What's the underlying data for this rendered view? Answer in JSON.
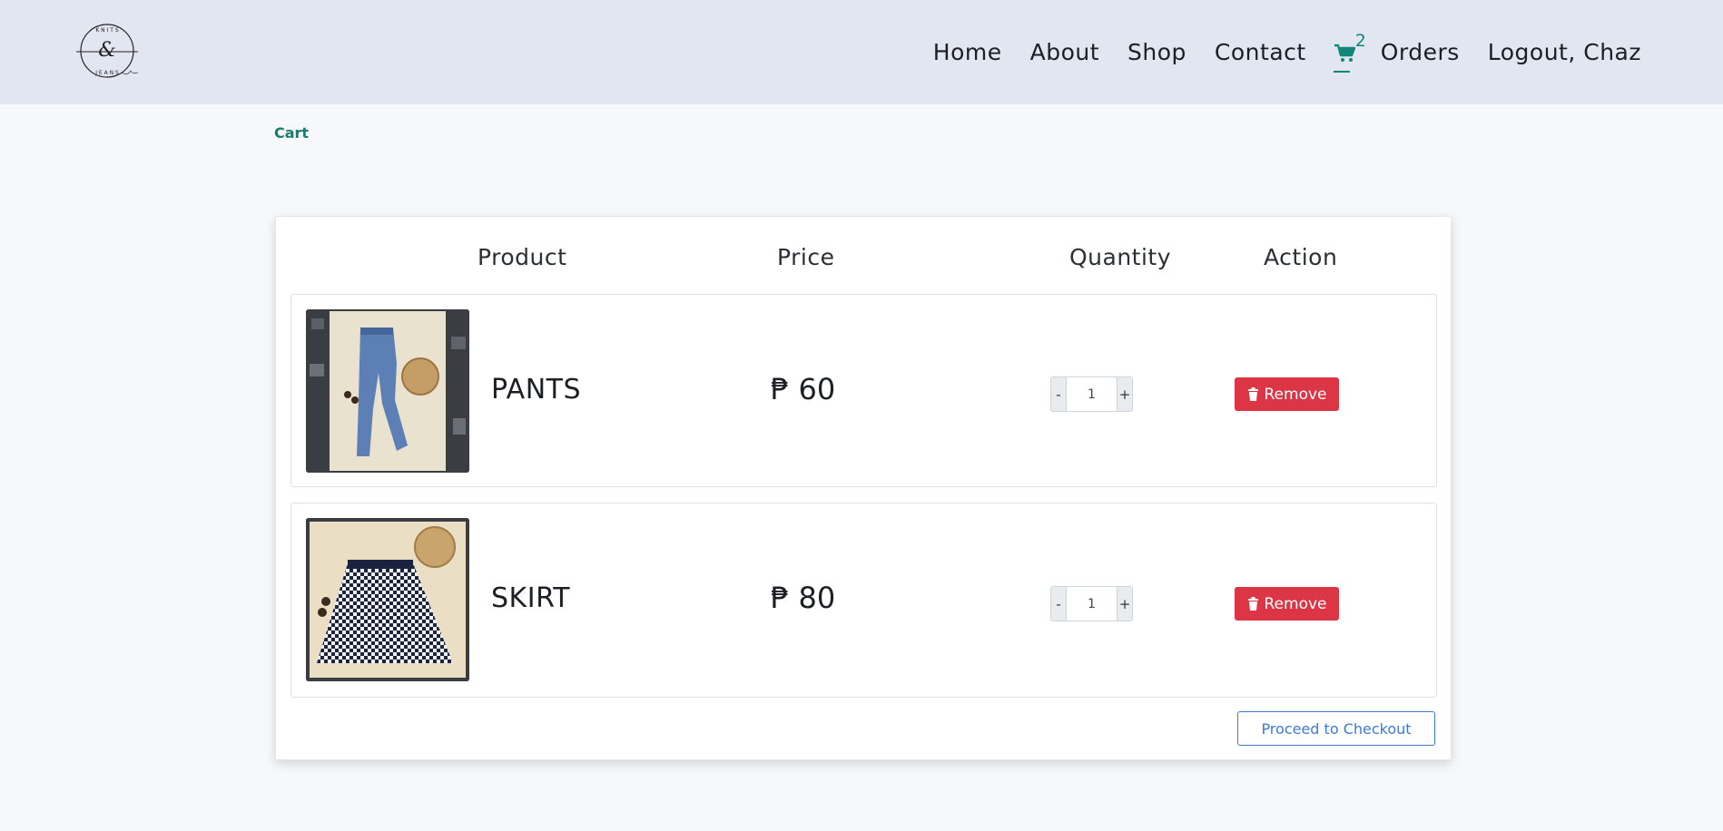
{
  "brand": {
    "logo_alt": "Knits & Jeans logo"
  },
  "nav": {
    "home": "Home",
    "about": "About",
    "shop": "Shop",
    "contact": "Contact",
    "cart_count": "2",
    "orders": "Orders",
    "logout": "Logout, Chaz"
  },
  "breadcrumb": "Cart",
  "table": {
    "headers": {
      "product": "Product",
      "price": "Price",
      "quantity": "Quantity",
      "action": "Action"
    },
    "items": [
      {
        "name": "PANTS",
        "price": "₱ 60",
        "quantity": "1",
        "minus": "-",
        "plus": "+",
        "remove": "Remove",
        "image": "jeans"
      },
      {
        "name": "SKIRT",
        "price": "₱ 80",
        "quantity": "1",
        "minus": "-",
        "plus": "+",
        "remove": "Remove",
        "image": "houndstooth skirt"
      }
    ]
  },
  "checkout_label": "Proceed to Checkout",
  "colors": {
    "navbar": "#e2e6f1",
    "accent": "#13857a",
    "danger": "#dc3545",
    "primary": "#3a7bd5"
  }
}
